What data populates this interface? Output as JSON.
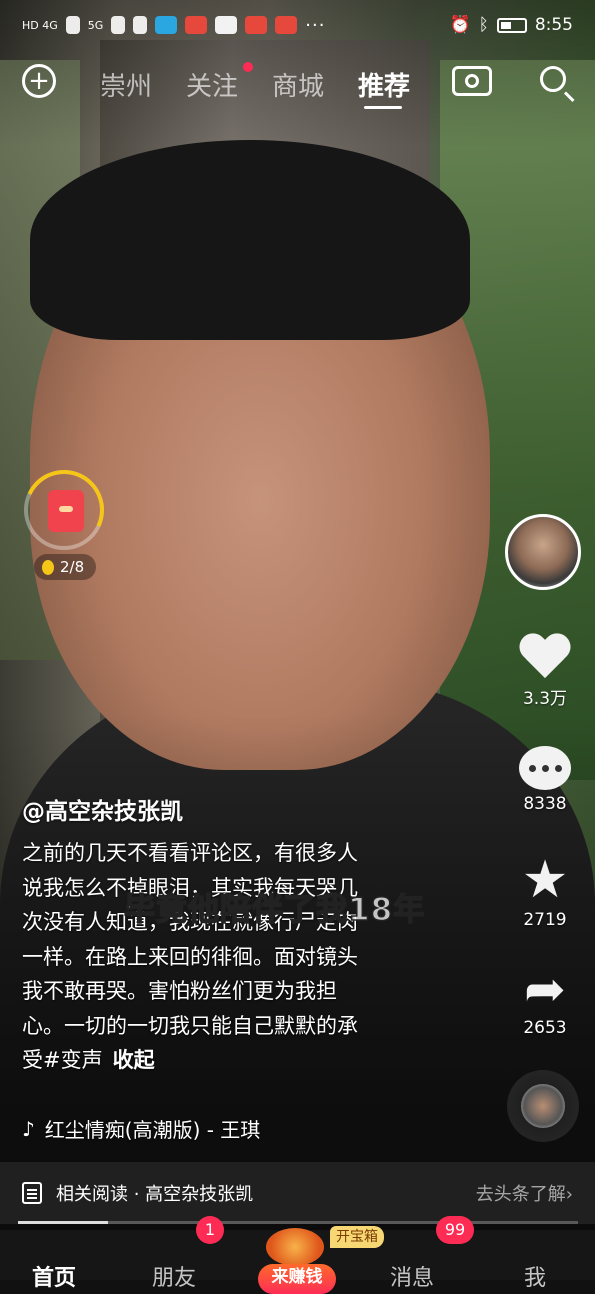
{
  "status_bar": {
    "network_left": "HD 4G",
    "signal_2": "5G",
    "time": "8:55",
    "overflow": "···",
    "icons": [
      "signal-icon",
      "wifi-icon",
      "telegram-icon",
      "weibo-icon",
      "message-icon",
      "weibo-icon",
      "weibo-icon",
      "alarm-icon",
      "bluetooth-icon",
      "battery-icon"
    ]
  },
  "top_nav": {
    "tabs": [
      {
        "label": "崇州",
        "active": false
      },
      {
        "label": "关注",
        "active": false,
        "has_dot": true
      },
      {
        "label": "商城",
        "active": false
      },
      {
        "label": "推荐",
        "active": true
      }
    ]
  },
  "red_packet": {
    "count": "2/8",
    "progress": 0.4
  },
  "side_actions": {
    "like_count": "3.3万",
    "comment_count": "8338",
    "favorite_count": "2719",
    "share_count": "2653"
  },
  "video": {
    "author": "@高空杂技张凯",
    "caption_lines": [
      "之前的几天不看看评论区，有很多人",
      "说我怎么不掉眼泪，其实我每天哭几",
      "次没有人知道，我现在就像行尸走肉",
      "一样。在路上来回的徘徊。面对镜头",
      "我不敢再哭。害怕粉丝们更为我担",
      "心。一切的一切我只能自己默默的承"
    ],
    "caption_tail": "受",
    "hashtag": "#变声",
    "collapse": "收起",
    "overlay_subtitle": "毕竟他陪伴了我18年",
    "music": "红尘情痴(高潮版) - 王琪",
    "progress": 0.16
  },
  "related": {
    "label": "相关阅读 · 高空杂技张凯",
    "link": "去头条了解"
  },
  "bottom_bar": {
    "home": "首页",
    "friends": "朋友",
    "friends_badge": "1",
    "earn": "来赚钱",
    "treasure_tag": "开宝箱",
    "messages": "消息",
    "messages_badge": "99",
    "me": "我"
  }
}
